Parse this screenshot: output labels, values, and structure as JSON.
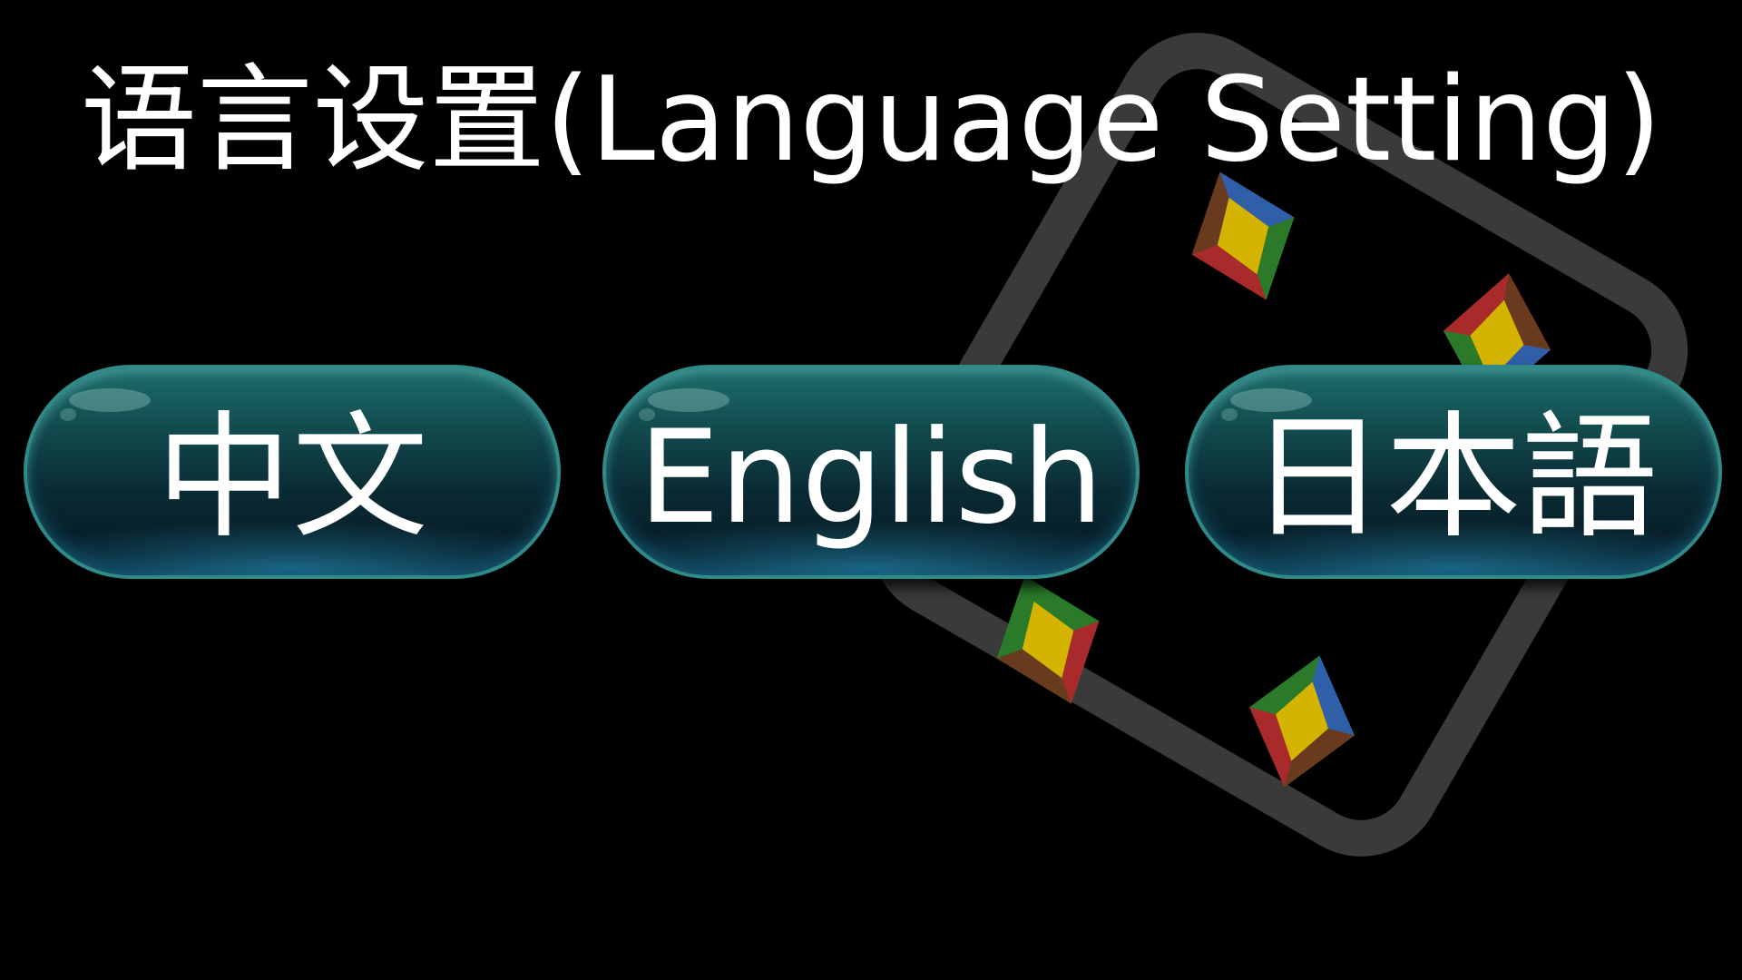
{
  "screen": {
    "title": "语言设置(Language Setting)"
  },
  "languages": [
    {
      "label": "中文"
    },
    {
      "label": "English"
    },
    {
      "label": "日本語"
    }
  ],
  "colors": {
    "background": "#000000",
    "button_border": "#2f8a88",
    "button_fill_top": "#1d6e6c",
    "button_fill_bottom": "#061722",
    "text": "#ffffff",
    "card_outline": "#3a3a3a"
  }
}
